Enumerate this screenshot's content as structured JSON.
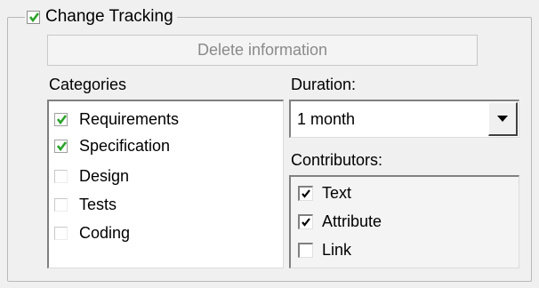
{
  "group": {
    "title": "Change Tracking",
    "checked": true
  },
  "delete_button": {
    "label": "Delete information",
    "enabled": false
  },
  "categories": {
    "label": "Categories",
    "items": [
      {
        "label": "Requirements",
        "checked": true
      },
      {
        "label": "Specification",
        "checked": true
      },
      {
        "label": "Design",
        "checked": false
      },
      {
        "label": "Tests",
        "checked": false
      },
      {
        "label": "Coding",
        "checked": false
      }
    ]
  },
  "duration": {
    "label": "Duration:",
    "value": "1 month"
  },
  "contributors": {
    "label": "Contributors:",
    "items": [
      {
        "label": "Text",
        "checked": true
      },
      {
        "label": "Attribute",
        "checked": true
      },
      {
        "label": "Link",
        "checked": false
      }
    ]
  },
  "colors": {
    "check_green": "#2aa22a",
    "check_black": "#000000",
    "disabled_text": "#8a8a8a"
  },
  "icons": {
    "group_check": "green-checkmark-icon",
    "list_check": "green-checkmark-icon",
    "contributor_check": "black-checkmark-icon",
    "combo_arrow": "triangle-down-icon"
  }
}
